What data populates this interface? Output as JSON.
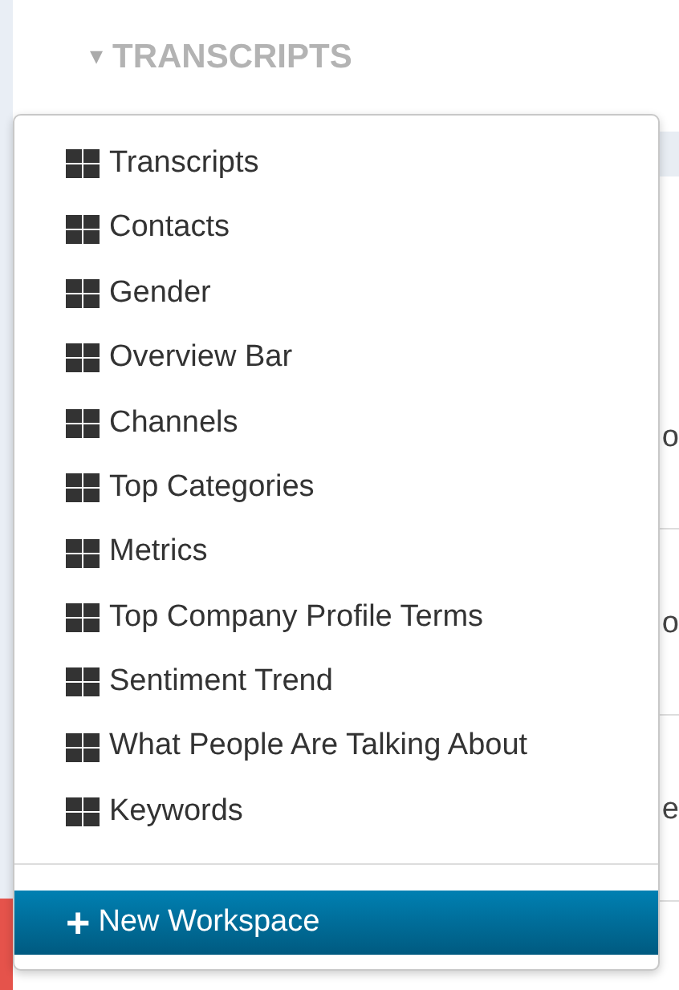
{
  "header": {
    "title": "TRANSCRIPTS",
    "caret": "▾"
  },
  "background_rows": [
    {
      "text": ""
    },
    {
      "text": "o"
    },
    {
      "text": "o"
    },
    {
      "text": "e"
    }
  ],
  "dropdown": {
    "items": [
      {
        "label": "Transcripts"
      },
      {
        "label": "Contacts"
      },
      {
        "label": "Gender"
      },
      {
        "label": "Overview Bar"
      },
      {
        "label": "Channels"
      },
      {
        "label": "Top Categories"
      },
      {
        "label": "Metrics"
      },
      {
        "label": "Top Company Profile Terms"
      },
      {
        "label": "Sentiment Trend"
      },
      {
        "label": "What People Are Talking About"
      },
      {
        "label": "Keywords"
      }
    ],
    "action": {
      "icon": "+",
      "label": "New Workspace"
    }
  }
}
